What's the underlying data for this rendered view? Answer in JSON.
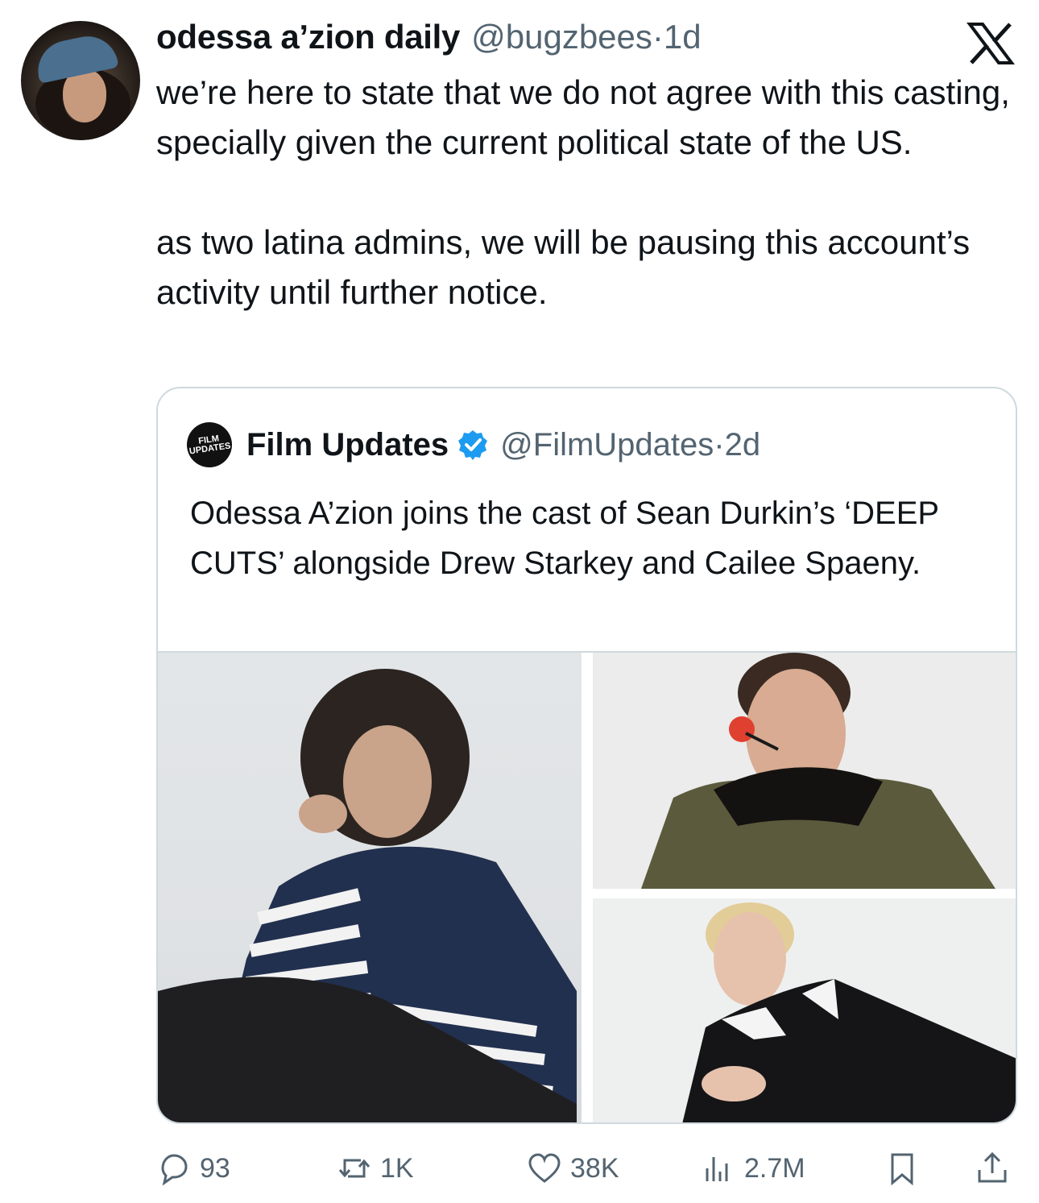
{
  "tweet": {
    "author_name": "odessa a’zion daily",
    "author_handle": "@bugzbees·1d",
    "text": "we’re here to state that we do not agree with this casting, specially given the current political state of the US.\n\nas two latina admins, we will be pausing this account’s activity until further notice."
  },
  "logo": {
    "icon": "x-logo-icon"
  },
  "quoted_tweet": {
    "author_name": "Film Updates",
    "author_handle": "@FilmUpdates·2d",
    "avatar_text_1": "FILM",
    "avatar_text_2": "UPDATES",
    "verified_icon": "verified-badge-icon",
    "verified_color": "#1d9bf0",
    "text": "Odessa A’zion joins the cast of Sean Durkin’s ‘DEEP CUTS’ alongside Drew Starkey and Cailee Spaeny."
  },
  "actions": {
    "reply": {
      "icon": "reply-icon",
      "count": "93"
    },
    "retweet": {
      "icon": "retweet-icon",
      "count": "1K"
    },
    "like": {
      "icon": "heart-icon",
      "count": "38K"
    },
    "views": {
      "icon": "views-icon",
      "count": "2.7M"
    },
    "bookmark": {
      "icon": "bookmark-icon"
    },
    "share": {
      "icon": "share-icon"
    }
  },
  "colors": {
    "text_primary": "#0f1419",
    "text_secondary": "#536471",
    "border": "#cfd9de"
  }
}
